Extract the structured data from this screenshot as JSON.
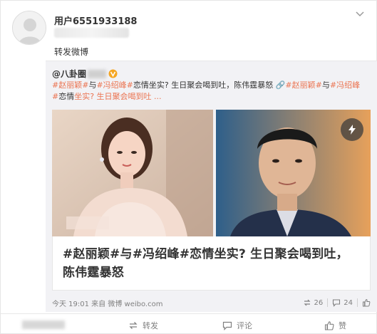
{
  "post": {
    "username": "用户6551933188",
    "repost_label": "转发微博"
  },
  "original": {
    "author_prefix": "@八卦圈",
    "text_segments": [
      {
        "text": "#赵丽颖#",
        "topic": true
      },
      {
        "text": "与",
        "topic": false
      },
      {
        "text": "#冯绍峰#",
        "topic": true
      },
      {
        "text": "恋情坐实? 生日聚会喝到吐，陈伟霆暴怒 ",
        "topic": false
      },
      {
        "text": "🔗",
        "topic": true,
        "icon": true
      },
      {
        "text": "#赵丽颖#",
        "topic": true
      },
      {
        "text": "与",
        "topic": false
      },
      {
        "text": "#冯绍峰#",
        "topic": true
      },
      {
        "text": "恋情",
        "topic": false
      },
      {
        "text": "坐实? 生日聚会喝到吐 ...",
        "topic": true
      }
    ],
    "headline": "#赵丽颖#与#冯绍峰#恋情坐实? 生日聚会喝到吐，陈伟霆暴怒",
    "footer": {
      "time_source": "今天 19:01 来自 微博 weibo.com",
      "repost_count": "26",
      "comment_count": "24"
    }
  },
  "actions": {
    "repost": "转发",
    "comment": "评论",
    "like": "赞"
  },
  "icons": {
    "more": "chevron-down-icon",
    "verified": "verified-v-icon",
    "flash": "lightning-icon",
    "repost": "repost-icon",
    "comment": "comment-icon",
    "like": "thumb-up-icon"
  },
  "colors": {
    "topic": "#eb7350",
    "verified": "#f5a623",
    "muted": "#808080"
  }
}
